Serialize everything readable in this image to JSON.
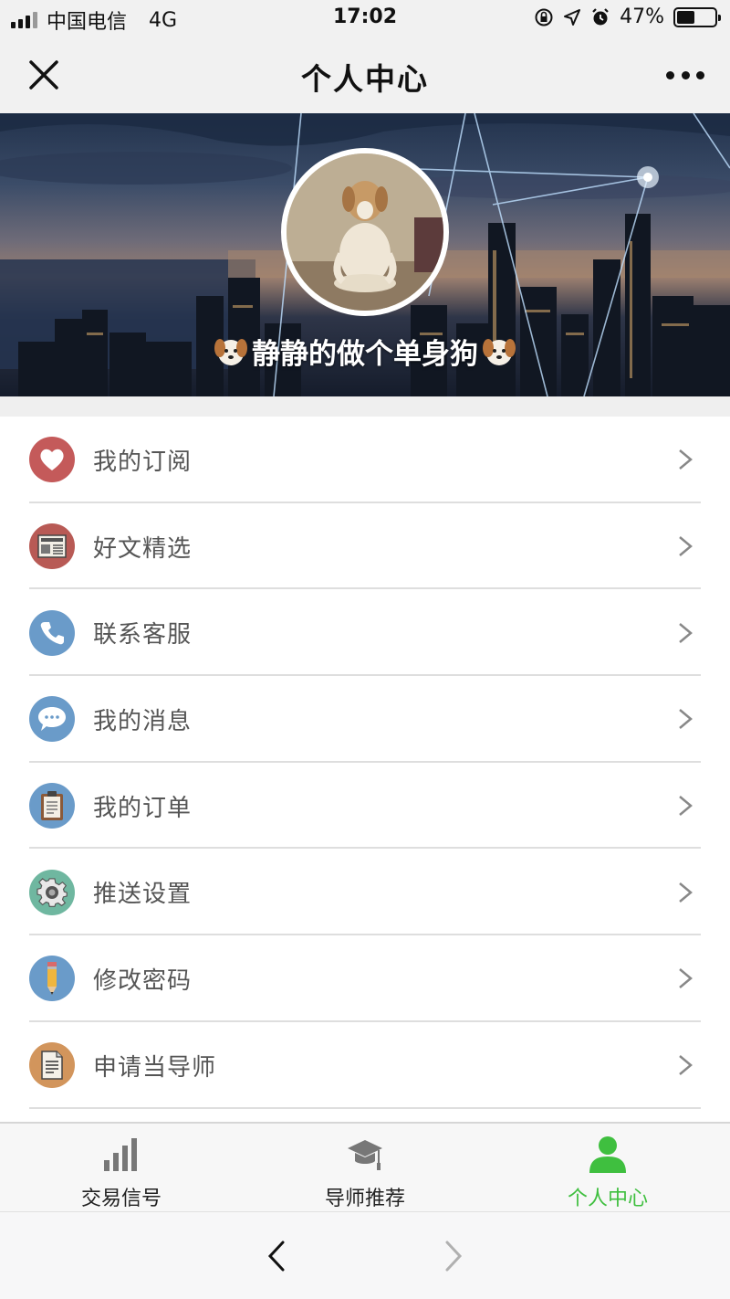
{
  "status_bar": {
    "carrier": "中国电信",
    "network": "4G",
    "time": "17:02",
    "battery": "47%",
    "battery_level": 0.47
  },
  "nav": {
    "title": "个人中心",
    "close_icon": "close-icon",
    "more_icon": "more-icon"
  },
  "profile": {
    "username": "静静的做个单身狗",
    "avatar_icon": "avatar"
  },
  "menu": {
    "items": [
      {
        "label": "我的订阅",
        "icon": "heart-icon",
        "color": "#c45a5a"
      },
      {
        "label": "好文精选",
        "icon": "newspaper-icon",
        "color": "#b85a55"
      },
      {
        "label": "联系客服",
        "icon": "phone-icon",
        "color": "#6a9bc9"
      },
      {
        "label": "我的消息",
        "icon": "chat-icon",
        "color": "#6a9bc9"
      },
      {
        "label": "我的订单",
        "icon": "clipboard-icon",
        "color": "#6a9bc9"
      },
      {
        "label": "推送设置",
        "icon": "gear-icon",
        "color": "#6fb7a0"
      },
      {
        "label": "修改密码",
        "icon": "pencil-icon",
        "color": "#6a9bc9"
      },
      {
        "label": "申请当导师",
        "icon": "document-icon",
        "color": "#d2955c"
      }
    ]
  },
  "tab_bar": {
    "tabs": [
      {
        "label": "交易信号",
        "icon": "bar-chart-icon",
        "active": false
      },
      {
        "label": "导师推荐",
        "icon": "graduation-cap-icon",
        "active": false
      },
      {
        "label": "个人中心",
        "icon": "person-icon",
        "active": true
      }
    ],
    "active_color": "#3fbf3f"
  },
  "browser": {
    "back_icon": "back-arrow-icon",
    "forward_icon": "forward-arrow-icon"
  }
}
